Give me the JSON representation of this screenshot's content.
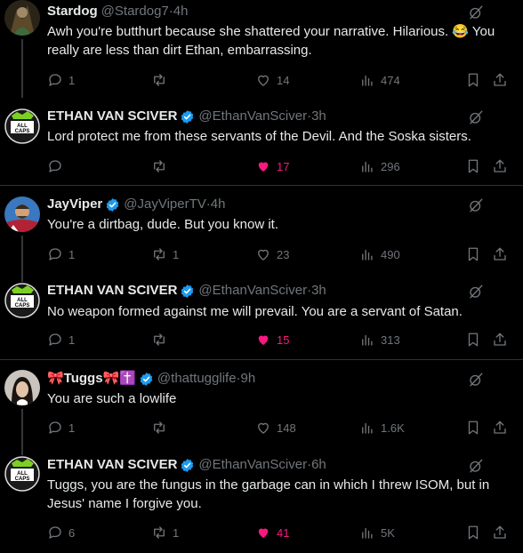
{
  "tweets": [
    {
      "name": "Stardog",
      "handle": "@Stardog7",
      "time": "4h",
      "verified": false,
      "text": "Awh you're butthurt because she shattered your narrative. Hilarious. 😂 You really are less than dirt Ethan, embarrassing.",
      "replies": "1",
      "retweets": "",
      "likes": "14",
      "views": "474",
      "liked": false
    },
    {
      "name": "ETHAN VAN SCIVER",
      "handle": "@EthanVanSciver",
      "time": "3h",
      "verified": true,
      "avatar_text": "ALL CAPS",
      "text": "Lord protect me from these servants of the Devil.  And the Soska sisters.",
      "replies": "",
      "retweets": "",
      "likes": "17",
      "views": "296",
      "liked": true
    },
    {
      "name": "JayViper",
      "handle": "@JayViperTV",
      "time": "4h",
      "verified": true,
      "text": "You're a dirtbag, dude. But you know it.",
      "replies": "1",
      "retweets": "1",
      "likes": "23",
      "views": "490",
      "liked": false
    },
    {
      "name": "ETHAN VAN SCIVER",
      "handle": "@EthanVanSciver",
      "time": "3h",
      "verified": true,
      "avatar_text": "ALL CAPS",
      "text": "No weapon formed against me will prevail.  You are a servant of Satan.",
      "replies": "1",
      "retweets": "",
      "likes": "15",
      "views": "313",
      "liked": true
    },
    {
      "name": "🎀Tuggs🎀✝️",
      "handle": "@thattugglife",
      "time": "9h",
      "verified": true,
      "text": "You are such a lowlife",
      "replies": "1",
      "retweets": "",
      "likes": "148",
      "views": "1.6K",
      "liked": false
    },
    {
      "name": "ETHAN VAN SCIVER",
      "handle": "@EthanVanSciver",
      "time": "6h",
      "verified": true,
      "avatar_text": "ALL CAPS",
      "text": "Tuggs, you are the fungus in the garbage can in which I threw ISOM, but in Jesus' name I forgive you.",
      "replies": "6",
      "retweets": "1",
      "likes": "41",
      "views": "5K",
      "liked": true
    }
  ],
  "separator": " · ",
  "colors": {
    "like_active": "#f91880",
    "verified": "#1d9bf0",
    "muted": "#71767b",
    "text": "#e7e9ea"
  }
}
